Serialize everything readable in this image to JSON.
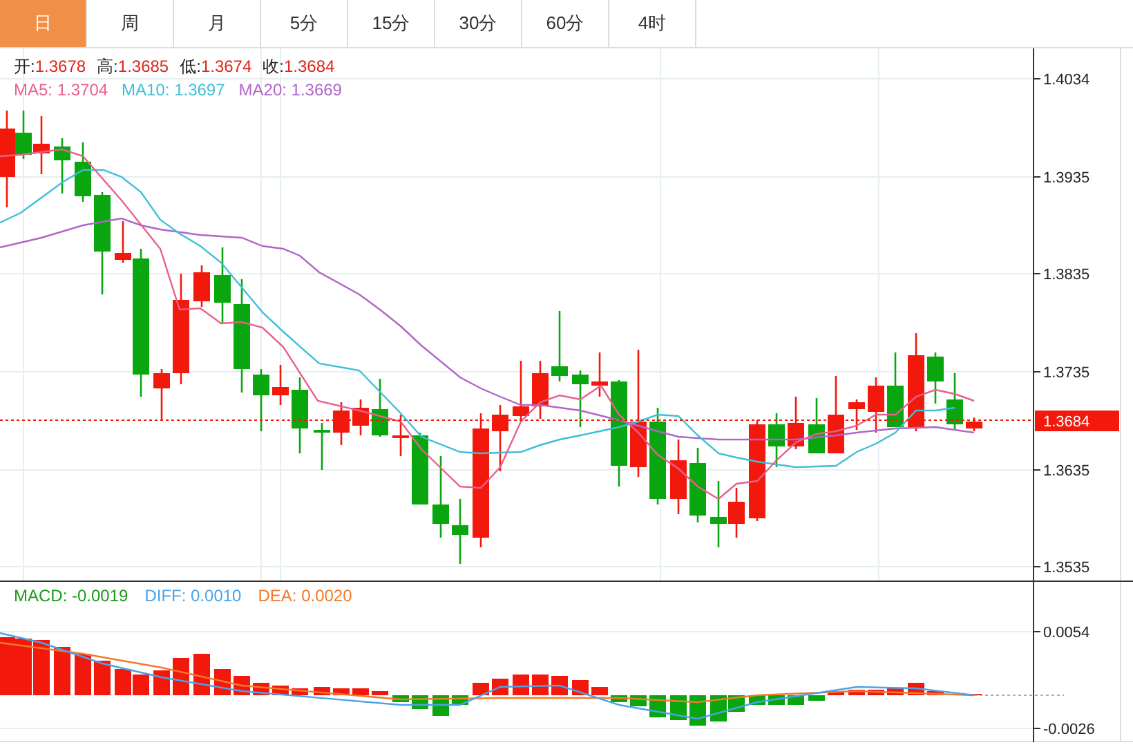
{
  "tabs": [
    {
      "label": "日",
      "selected": true
    },
    {
      "label": "周",
      "selected": false
    },
    {
      "label": "月",
      "selected": false
    },
    {
      "label": "5分",
      "selected": false
    },
    {
      "label": "15分",
      "selected": false
    },
    {
      "label": "30分",
      "selected": false
    },
    {
      "label": "60分",
      "selected": false
    },
    {
      "label": "4时",
      "selected": false
    }
  ],
  "price_legend": [
    {
      "label": "开:",
      "value": "1.3678"
    },
    {
      "label": "高:",
      "value": "1.3685"
    },
    {
      "label": "低:",
      "value": "1.3674"
    },
    {
      "label": "收:",
      "value": "1.3684"
    }
  ],
  "ma_legend": [
    {
      "text": "MA5: 1.3704",
      "color": "#e8608e"
    },
    {
      "text": "MA10: 1.3697",
      "color": "#3fbfd6"
    },
    {
      "text": "MA20: 1.3669",
      "color": "#b066c8"
    }
  ],
  "price_axis": [
    "1.4034",
    "1.3935",
    "1.3835",
    "1.3735",
    "1.3635",
    "1.3535"
  ],
  "current_price": "1.3684",
  "macd_legend": [
    {
      "text": "MACD: -0.0019",
      "color": "#1a9a1a"
    },
    {
      "text": "DIFF: 0.0010",
      "color": "#4aa3e8"
    },
    {
      "text": "DEA: 0.0020",
      "color": "#f07a2a"
    }
  ],
  "macd_axis": [
    "0.0054",
    "-0.0026"
  ]
}
